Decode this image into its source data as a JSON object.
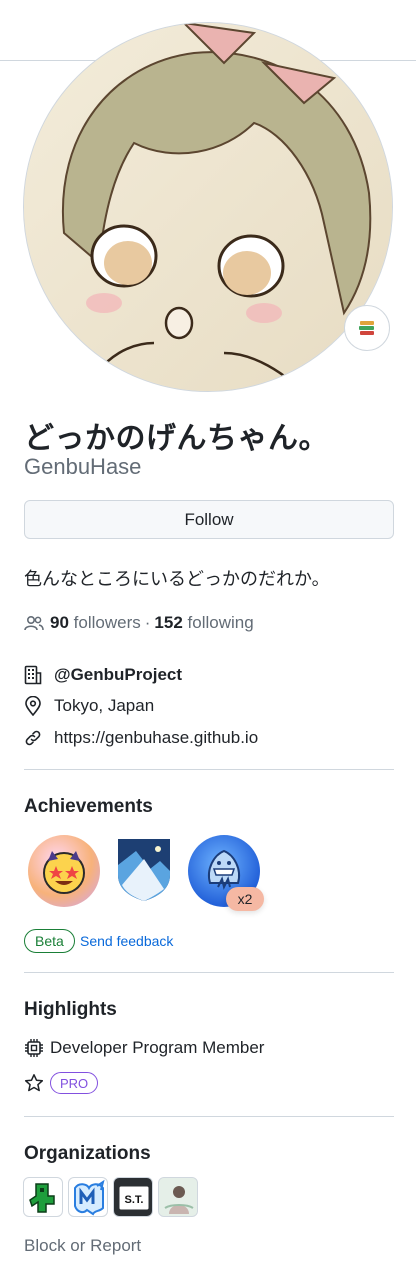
{
  "profile": {
    "display_name": "どっかのげんちゃん。",
    "login": "GenbuHase",
    "follow_label": "Follow",
    "bio": "色んなところにいるどっかのだれか。",
    "followers_count": "90",
    "followers_label": "followers",
    "separator": "·",
    "following_count": "152",
    "following_label": "following",
    "status_icon": "books-emoji-icon",
    "avatar_icon": "anime-girl-avatar"
  },
  "vcard": {
    "organization": "@GenbuProject",
    "location": "Tokyo, Japan",
    "website": "https://genbuhase.github.io"
  },
  "achievements": {
    "title": "Achievements",
    "badges": [
      {
        "name": "starstruck-badge"
      },
      {
        "name": "arctic-code-vault-badge"
      },
      {
        "name": "shark-badge",
        "count": "x2"
      }
    ],
    "beta_label": "Beta",
    "feedback_label": "Send feedback"
  },
  "highlights": {
    "title": "Highlights",
    "developer_program": "Developer Program Member",
    "pro_label": "PRO"
  },
  "organizations": {
    "title": "Organizations",
    "items": [
      {
        "name": "org-green-figure-icon"
      },
      {
        "name": "org-blue-map-icon"
      },
      {
        "name": "org-st-icon",
        "text": "S.T."
      },
      {
        "name": "org-illustration-icon"
      }
    ]
  },
  "footer": {
    "block_label": "Block or Report"
  },
  "colors": {
    "accent_link": "#0969da",
    "beta_green": "#1a7f37",
    "pro_purple": "#8250df",
    "muted": "#636c76"
  }
}
